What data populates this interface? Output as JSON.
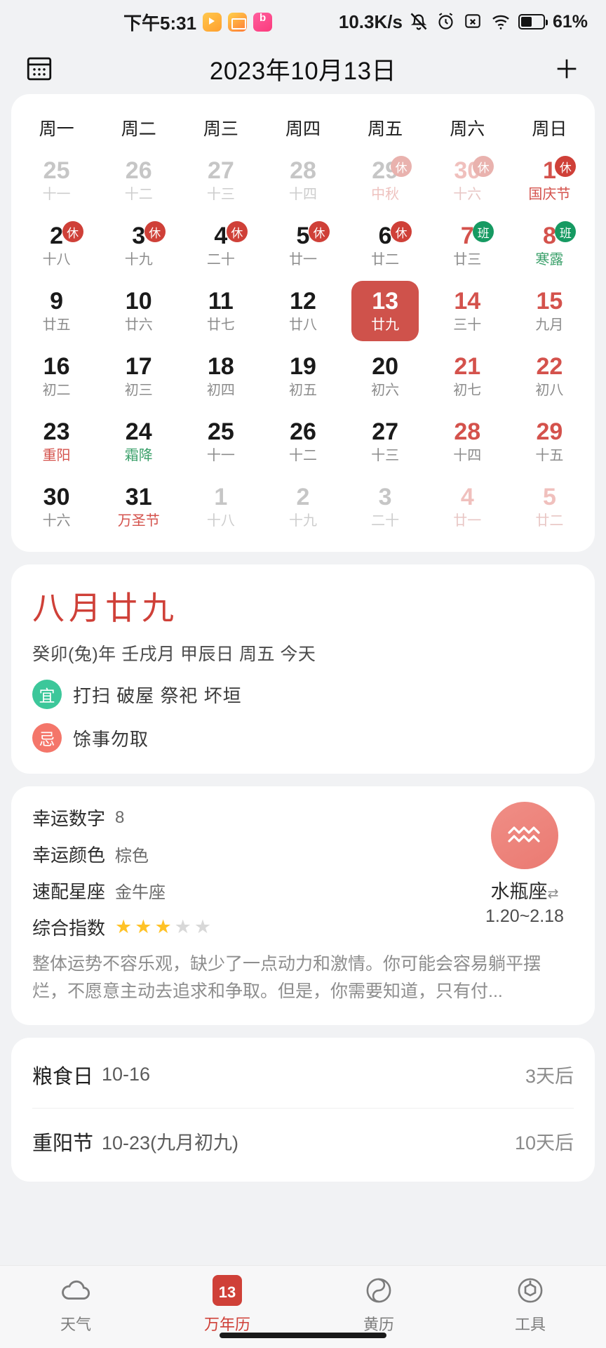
{
  "statusbar": {
    "time": "下午5:31",
    "app_icons": [
      "app-icon-1",
      "mail-icon",
      "bilibili-icon"
    ],
    "network_speed": "10.3K/s",
    "icons": [
      "mute-icon",
      "alarm-icon",
      "no-sim-icon",
      "wifi-icon",
      "battery-icon"
    ],
    "battery_percent": "61%"
  },
  "header": {
    "menu_icon": "calendar-grid-icon",
    "title": "2023年10月13日",
    "add_icon": "plus-icon"
  },
  "calendar": {
    "weekdays": [
      "周一",
      "周二",
      "周三",
      "周四",
      "周五",
      "周六",
      "周日"
    ],
    "weeks": [
      [
        {
          "day": "25",
          "sub": "十一",
          "out": true
        },
        {
          "day": "26",
          "sub": "十二",
          "out": true
        },
        {
          "day": "27",
          "sub": "十三",
          "out": true
        },
        {
          "day": "28",
          "sub": "十四",
          "out": true
        },
        {
          "day": "29",
          "sub": "中秋",
          "out": true,
          "fest": true,
          "badge": "休"
        },
        {
          "day": "30",
          "sub": "十六",
          "out": true,
          "weekend": true,
          "badge": "休"
        },
        {
          "day": "1",
          "sub": "国庆节",
          "fest": true,
          "weekend": true,
          "badge": "休"
        }
      ],
      [
        {
          "day": "2",
          "sub": "十八",
          "badge": "休"
        },
        {
          "day": "3",
          "sub": "十九",
          "badge": "休"
        },
        {
          "day": "4",
          "sub": "二十",
          "badge": "休"
        },
        {
          "day": "5",
          "sub": "廿一",
          "badge": "休"
        },
        {
          "day": "6",
          "sub": "廿二",
          "badge": "休"
        },
        {
          "day": "7",
          "sub": "廿三",
          "weekend": true,
          "badge": "班"
        },
        {
          "day": "8",
          "sub": "寒露",
          "term": true,
          "weekend": true,
          "badge": "班"
        }
      ],
      [
        {
          "day": "9",
          "sub": "廿五"
        },
        {
          "day": "10",
          "sub": "廿六"
        },
        {
          "day": "11",
          "sub": "廿七"
        },
        {
          "day": "12",
          "sub": "廿八"
        },
        {
          "day": "13",
          "sub": "廿九",
          "selected": true
        },
        {
          "day": "14",
          "sub": "三十",
          "weekend": true
        },
        {
          "day": "15",
          "sub": "九月",
          "weekend": true
        }
      ],
      [
        {
          "day": "16",
          "sub": "初二"
        },
        {
          "day": "17",
          "sub": "初三"
        },
        {
          "day": "18",
          "sub": "初四"
        },
        {
          "day": "19",
          "sub": "初五"
        },
        {
          "day": "20",
          "sub": "初六"
        },
        {
          "day": "21",
          "sub": "初七",
          "weekend": true
        },
        {
          "day": "22",
          "sub": "初八",
          "weekend": true
        }
      ],
      [
        {
          "day": "23",
          "sub": "重阳",
          "fest": true
        },
        {
          "day": "24",
          "sub": "霜降",
          "term": true
        },
        {
          "day": "25",
          "sub": "十一"
        },
        {
          "day": "26",
          "sub": "十二"
        },
        {
          "day": "27",
          "sub": "十三"
        },
        {
          "day": "28",
          "sub": "十四",
          "weekend": true
        },
        {
          "day": "29",
          "sub": "十五",
          "weekend": true
        }
      ],
      [
        {
          "day": "30",
          "sub": "十六"
        },
        {
          "day": "31",
          "sub": "万圣节",
          "fest": true
        },
        {
          "day": "1",
          "sub": "十八",
          "out": true
        },
        {
          "day": "2",
          "sub": "十九",
          "out": true
        },
        {
          "day": "3",
          "sub": "二十",
          "out": true
        },
        {
          "day": "4",
          "sub": "廿一",
          "out": true,
          "weekend": true
        },
        {
          "day": "5",
          "sub": "廿二",
          "out": true,
          "weekend": true
        }
      ]
    ]
  },
  "lunar": {
    "title": "八月廿九",
    "ganzhi": "癸卯(兔)年 壬戌月 甲辰日 周五  今天",
    "yi_label": "宜",
    "yi_text": "打扫 破屋 祭祀 坏垣",
    "ji_label": "忌",
    "ji_text": "馀事勿取"
  },
  "horoscope": {
    "lucky_number_label": "幸运数字",
    "lucky_number": "8",
    "lucky_color_label": "幸运颜色",
    "lucky_color": "棕色",
    "match_sign_label": "速配星座",
    "match_sign": "金牛座",
    "rating_label": "综合指数",
    "rating": 3,
    "rating_max": 5,
    "sign_name": "水瓶座",
    "sign_icon": "aquarius-icon",
    "swap_icon": "swap-icon",
    "sign_dates": "1.20~2.18",
    "description": "整体运势不容乐观，缺少了一点动力和激情。你可能会容易躺平摆烂，不愿意主动去追求和争取。但是，你需要知道，只有付..."
  },
  "festivals": [
    {
      "name": "粮食日",
      "date": "10-16",
      "countdown": "3天后"
    },
    {
      "name": "重阳节",
      "date": "10-23(九月初九)",
      "countdown": "10天后"
    }
  ],
  "nav": [
    {
      "label": "天气",
      "icon": "cloud-icon",
      "active": false
    },
    {
      "label": "万年历",
      "icon": "calendar-icon",
      "badge": "13",
      "active": true
    },
    {
      "label": "黄历",
      "icon": "almanac-icon",
      "active": false
    },
    {
      "label": "工具",
      "icon": "tools-icon",
      "active": false
    }
  ],
  "colors": {
    "accent": "#cf4038",
    "weekend": "#d4524c",
    "term": "#3aa06a",
    "work_badge": "#169a62"
  }
}
